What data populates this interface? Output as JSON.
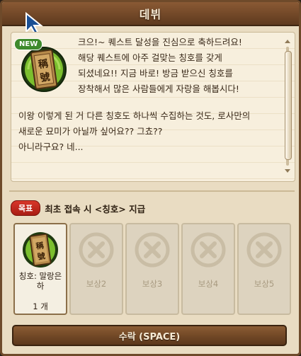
{
  "window": {
    "title": "데뷔"
  },
  "message": {
    "badge": "NEW",
    "line_block_1": "크으!~ 퀘스트 달성을 진심으로 축하드려요!\n해당 퀘스트에 아주 걸맞는 칭호를 갖게\n되셨네요!! 지금 바로! 방금 받으신 칭호를\n장착해서 많은 사람들에게 자랑을 해봅시다!",
    "line_block_2": "이왕 이렇게 된 거 다른 칭호도 하나씩 수집하는 것도, 로사만의\n새로운 묘미가 아닐까 싶어요?? 그쵸??\n아니라구요? 네..."
  },
  "goal": {
    "tag": "목표",
    "text": "최초 접속 시 <칭호> 지급"
  },
  "rewards": [
    {
      "label": "칭호: 말랑은\n하",
      "count": "1 개",
      "icon": "title-medal-icon",
      "active": true
    },
    {
      "label": "보상2",
      "icon": "x-icon",
      "active": false
    },
    {
      "label": "보상3",
      "icon": "x-icon",
      "active": false
    },
    {
      "label": "보상4",
      "icon": "x-icon",
      "active": false
    },
    {
      "label": "보상5",
      "icon": "x-icon",
      "active": false
    }
  ],
  "accept_button": {
    "label": "수락 (SPACE)"
  },
  "colors": {
    "accent_red": "#c52a1e",
    "frame_brown": "#6e4a2a",
    "badge_green": "#3e8a2c"
  }
}
